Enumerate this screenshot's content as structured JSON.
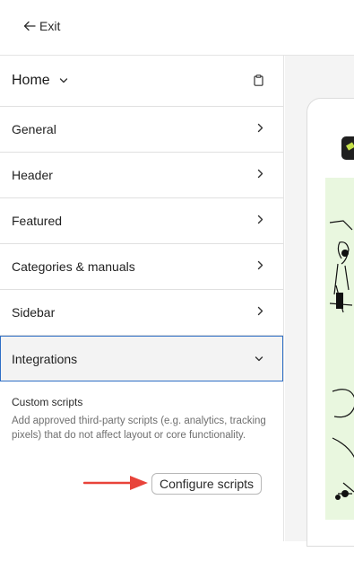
{
  "topbar": {
    "exit_label": "Exit"
  },
  "sidebar": {
    "page_title": "Home",
    "sections": [
      {
        "label": "General"
      },
      {
        "label": "Header"
      },
      {
        "label": "Featured"
      },
      {
        "label": "Categories & manuals"
      },
      {
        "label": "Sidebar"
      },
      {
        "label": "Integrations"
      }
    ],
    "integrations": {
      "title": "Custom scripts",
      "description": "Add approved third-party scripts (e.g. analytics, tracking pixels) that do not affect layout or core functionality.",
      "button_label": "Configure scripts"
    }
  },
  "colors": {
    "active_border": "#2f6fc6",
    "annotation_arrow": "#e8433a",
    "preview_hero": "#e9f7df"
  }
}
